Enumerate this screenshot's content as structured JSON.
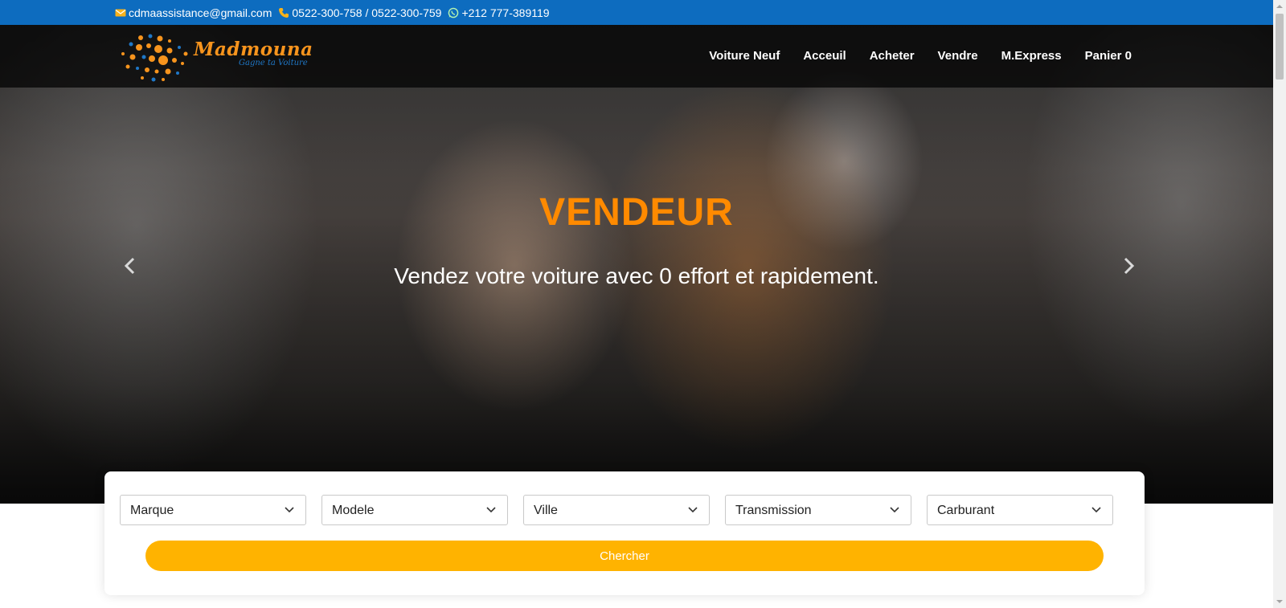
{
  "topbar": {
    "email": "cdmaassistance@gmail.com",
    "phones": "0522-300-758 / 0522-300-759",
    "whatsapp": "+212 777-389119"
  },
  "brand": {
    "name": "Madmouna",
    "tagline": "Gagne ta Voiture",
    "colors": {
      "orange": "#f7941d",
      "blue": "#1f78c8"
    }
  },
  "nav": {
    "items": [
      "Voiture Neuf",
      "Acceuil",
      "Acheter",
      "Vendre",
      "M.Express",
      "Panier 0"
    ]
  },
  "hero": {
    "title": "VENDEUR",
    "subtitle": "Vendez votre voiture avec 0 effort et rapidement.",
    "title_color": "#ff8a00"
  },
  "search": {
    "selects": [
      "Marque",
      "Modele",
      "Ville",
      "Transmission",
      "Carburant"
    ],
    "button_label": "Chercher",
    "button_color": "#ffb300"
  },
  "icons": {
    "email": "envelope-icon",
    "phone": "phone-icon",
    "whatsapp": "whatsapp-icon",
    "prev": "chevron-left-icon",
    "next": "chevron-right-icon",
    "dropdown": "chevron-down-icon"
  }
}
